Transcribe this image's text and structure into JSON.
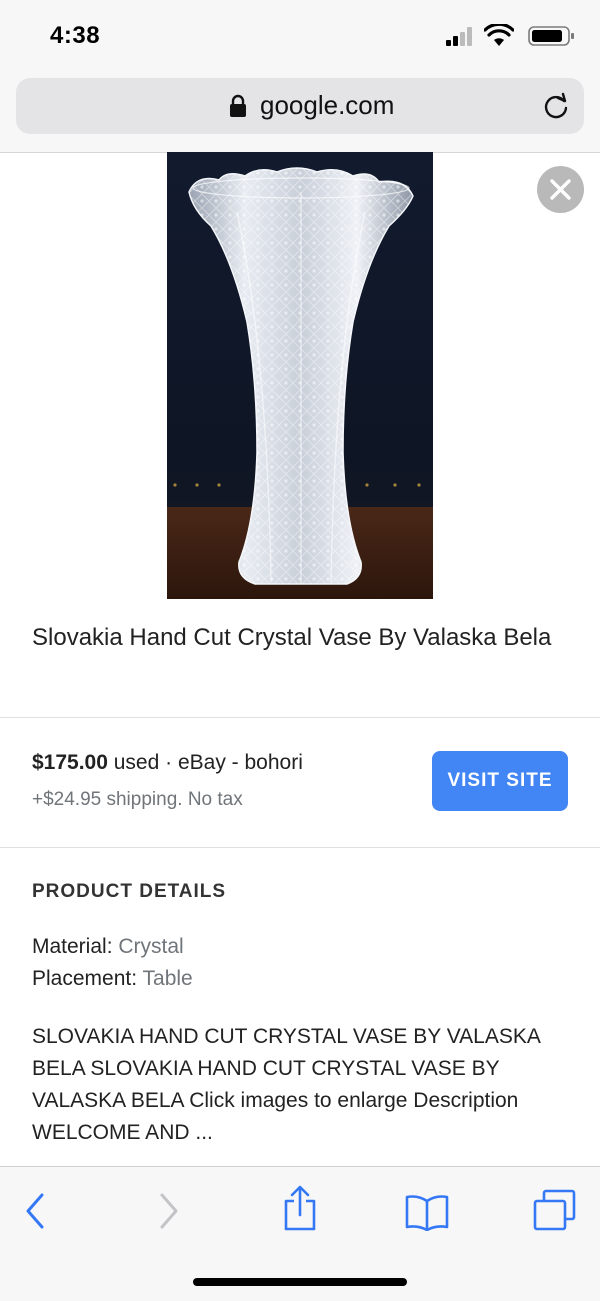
{
  "status_bar": {
    "time": "4:38"
  },
  "browser": {
    "url": "google.com"
  },
  "product": {
    "title": "Slovakia Hand Cut Crystal Vase By Valaska Bela",
    "image_alt": "crystal vase"
  },
  "offer": {
    "price": "$175.00",
    "condition": " used",
    "separator": " · ",
    "seller": "eBay - bohori",
    "shipping": "+$24.95 shipping. No tax",
    "visit_label": "VISIT SITE"
  },
  "details": {
    "heading": "PRODUCT DETAILS",
    "items": [
      {
        "key": "Material:",
        "value": "Crystal"
      },
      {
        "key": "Placement:",
        "value": "Table"
      }
    ],
    "description": "SLOVAKIA HAND CUT CRYSTAL VASE BY VALASKA BELA SLOVAKIA HAND CUT CRYSTAL VASE BY VALASKA BELA Click images to enlarge Description WELCOME AND ..."
  },
  "toolbar": {
    "icons": [
      "back-icon",
      "forward-icon",
      "share-icon",
      "bookmarks-icon",
      "tabs-icon"
    ]
  },
  "colors": {
    "accent": "#4285f4",
    "toolbar_icon": "#3478f6",
    "disabled_icon": "#c4c4c8"
  }
}
